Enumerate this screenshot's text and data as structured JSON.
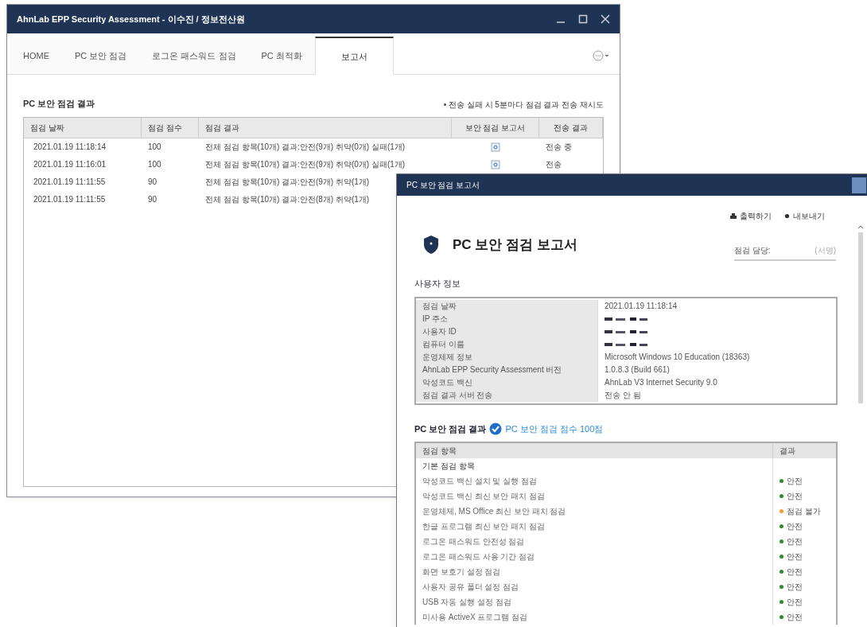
{
  "main_window": {
    "title": "AhnLab EPP Security Assessment - 이수진 / 정보전산원",
    "tabs": [
      {
        "label": "HOME",
        "selected": false
      },
      {
        "label": "PC 보안 점검",
        "selected": false
      },
      {
        "label": "로그온 패스워드 점검",
        "selected": false
      },
      {
        "label": "PC 최적화",
        "selected": false
      },
      {
        "label": "보고서",
        "selected": true
      }
    ],
    "section_title": "PC 보안 점검 결과",
    "note": "• 전송 실패 시 5분마다 점검 결과 전송 재시도",
    "table": {
      "columns": [
        "점검 날짜",
        "점검 점수",
        "점검 결과",
        "보안 점검 보고서",
        "전송 결과"
      ],
      "rows": [
        {
          "date": "2021.01.19 11:18:14",
          "score": "100",
          "result": "전체 점검 항목(10개) 결과:안전(9개) 취약(0개) 실패(1개)",
          "transfer": "전송 중"
        },
        {
          "date": "2021.01.19 11:16:01",
          "score": "100",
          "result": "전체 점검 항목(10개) 결과:안전(9개) 취약(0개) 실패(1개)",
          "transfer": "전송"
        },
        {
          "date": "2021.01.19 11:11:55",
          "score": "90",
          "result": "전체 점검 항목(10개) 결과:안전(9개) 취약(1개)"
        },
        {
          "date": "2021.01.19 11:11:55",
          "score": "90",
          "result": "전체 점검 항목(10개) 결과:안전(8개) 취약(1개)"
        }
      ]
    }
  },
  "report_window": {
    "title": "PC 보안 점검 보고서",
    "actions": [
      "출력하기",
      "내보내기"
    ],
    "heading": "PC 보안 점검 보고서",
    "inspector": {
      "label": "점검 담당:",
      "placeholder": "(서명)"
    },
    "user_info_title": "사용자 정보",
    "user_info": [
      {
        "label": "점검 날짜",
        "value": "2021.01.19 11:18:14"
      },
      {
        "label": "IP 주소",
        "redacted": true
      },
      {
        "label": "사용자 ID",
        "redacted": true
      },
      {
        "label": "컴퓨터 이름",
        "redacted": true
      },
      {
        "label": "운영체제 정보",
        "value": "Microsoft Windows 10 Education (18363)"
      },
      {
        "label": "AhnLab EPP Security Assessment 버전",
        "value": "1.0.8.3 (Build 661)"
      },
      {
        "label": "악성코드 백신",
        "value": "AhnLab V3 Internet Security 9.0"
      },
      {
        "label": "점검 결과 서버 전송",
        "value": "전송 안 됨"
      }
    ],
    "results_title": "PC 보안 점검 결과",
    "score_text": "PC 보안 점검 점수 100점",
    "results_columns": [
      "점검 항목",
      "결과"
    ],
    "results": [
      {
        "kind": "category",
        "item": "기본 점검 항목"
      },
      {
        "kind": "item",
        "item": "악성코드 백신 설치 및 실행 점검",
        "result": "안전",
        "color": "#2e8b2e"
      },
      {
        "kind": "item",
        "item": "악성코드 백신 최신 보안 패치 점검",
        "result": "안전",
        "color": "#2e8b2e"
      },
      {
        "kind": "item",
        "item": "운영체제, MS Office 최신 보안 패치 점검",
        "result": "점검 불가",
        "color": "#f0a030"
      },
      {
        "kind": "item",
        "item": "한글 프로그램 최신 보안 패치 점검",
        "result": "안전",
        "color": "#2e8b2e"
      },
      {
        "kind": "item",
        "item": "로그온 패스워드 안전성 점검",
        "result": "안전",
        "color": "#2e8b2e"
      },
      {
        "kind": "item",
        "item": "로그온 패스워드 사용 기간 점검",
        "result": "안전",
        "color": "#2e8b2e"
      },
      {
        "kind": "item",
        "item": "화면 보호기 설정 점검",
        "result": "안전",
        "color": "#2e8b2e"
      },
      {
        "kind": "item",
        "item": "사용자 공유 폴더 설정 점검",
        "result": "안전",
        "color": "#2e8b2e"
      },
      {
        "kind": "item",
        "item": "USB 자동 실행 설정 점검",
        "result": "안전",
        "color": "#2e8b2e"
      },
      {
        "kind": "item",
        "item": "미사용 ActiveX 프로그램 점검",
        "result": "안전",
        "color": "#2e8b2e"
      }
    ]
  }
}
